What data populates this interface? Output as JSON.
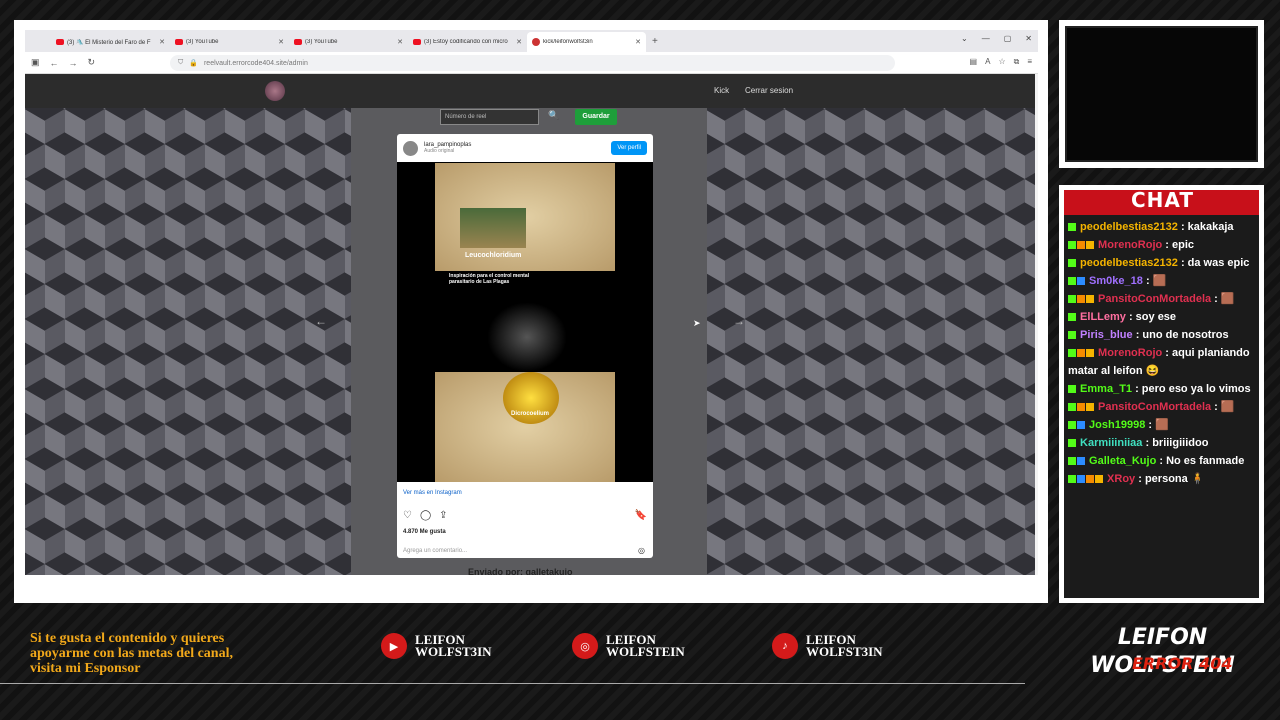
{
  "browser": {
    "tabs": [
      {
        "label": "(3) 🛝 El Misterio del Faro de F",
        "icon": "youtube-icon"
      },
      {
        "label": "(3) YouTube",
        "icon": "youtube-icon"
      },
      {
        "label": "(3) YouTube",
        "icon": "youtube-icon"
      },
      {
        "label": "(3) Estoy codificando con micro",
        "icon": "youtube-icon"
      },
      {
        "label": "kick/leifonwolfst3in",
        "icon": "kick-icon"
      }
    ],
    "url": "reelvault.errorcode404.site/admin",
    "newtab": "+"
  },
  "site": {
    "nav_links": [
      "Kick",
      "Cerrar sesion"
    ],
    "search_placeholder": "Número de reel",
    "save_label": "Guardar",
    "post": {
      "username": "lara_pampinoplas",
      "subtitle": "Audio original",
      "view_profile": "Ver perfil",
      "image_label_1": "Leucochloridium",
      "image_caption": "Inspiración para el control mental parasitario de Las Plagas",
      "image_label_2": "Dicrocoelium",
      "view_more": "Ver más en Instagram",
      "likes": "4.870 Me gusta",
      "comment_placeholder": "Agrega un comentario..."
    },
    "sent_by": "Enviado por: galletakujo"
  },
  "chat": {
    "title": "CHAT",
    "messages": [
      {
        "user": "peodelbestias2132",
        "color": "#f5b400",
        "badges": [
          "bg"
        ],
        "text": ": kakakaja"
      },
      {
        "user": "MorenoRojo",
        "color": "#e03050",
        "badges": [
          "bg",
          "bo",
          "by"
        ],
        "text": ": epic"
      },
      {
        "user": "peodelbestias2132",
        "color": "#f5b400",
        "badges": [
          "bg"
        ],
        "text": ": da was epic"
      },
      {
        "user": "Sm0ke_18",
        "color": "#a070ff",
        "badges": [
          "bg",
          "bb"
        ],
        "text": ": 🟫"
      },
      {
        "user": "PansitoConMortadela",
        "color": "#e03050",
        "badges": [
          "bg",
          "bo",
          "by"
        ],
        "text": ": 🟫"
      },
      {
        "user": "ElLLemy",
        "color": "#ff6fa0",
        "badges": [
          "bg"
        ],
        "text": ": soy ese"
      },
      {
        "user": "Piris_blue",
        "color": "#c080ff",
        "badges": [
          "bg"
        ],
        "text": ": uno de nosotros"
      },
      {
        "user": "MorenoRojo",
        "color": "#e03050",
        "badges": [
          "bg",
          "bo",
          "by"
        ],
        "text": ": aqui planiando matar al leifon 😆"
      },
      {
        "user": "Emma_T1",
        "color": "#53fc18",
        "badges": [
          "bg"
        ],
        "text": ": pero eso ya lo vimos"
      },
      {
        "user": "PansitoConMortadela",
        "color": "#e03050",
        "badges": [
          "bg",
          "bo",
          "by"
        ],
        "text": ": 🟫"
      },
      {
        "user": "Josh19998",
        "color": "#53fc18",
        "badges": [
          "bg",
          "bb"
        ],
        "text": ": 🟫"
      },
      {
        "user": "Karmiiiniiaa",
        "color": "#40e0c0",
        "badges": [
          "bg"
        ],
        "text": ": briiigiiidoo"
      },
      {
        "user": "Galleta_Kujo",
        "color": "#53fc18",
        "badges": [
          "bg",
          "bb"
        ],
        "text": ": No es fanmade"
      },
      {
        "user": "XRoy",
        "color": "#e03050",
        "badges": [
          "bg",
          "bb",
          "bo",
          "by"
        ],
        "text": ": persona 🧍"
      }
    ]
  },
  "footer": {
    "sponsor_text_1": "Si te gusta el contenido y quieres",
    "sponsor_text_2": "apoyarme con las metas del canal,",
    "sponsor_text_3": "visita mi Esponsor",
    "socials": [
      {
        "icon": "youtube-icon",
        "line1": "LEIFON",
        "line2": "WOLFST3IN"
      },
      {
        "icon": "instagram-icon",
        "line1": "LEIFON",
        "line2": "WOLFSTEIN"
      },
      {
        "icon": "tiktok-icon",
        "line1": "LEIFON",
        "line2": "WOLFST3IN"
      }
    ],
    "brand_1": "LEIFON",
    "brand_2": "WOLFSTEIN",
    "brand_overlay": "ERROR 404"
  }
}
